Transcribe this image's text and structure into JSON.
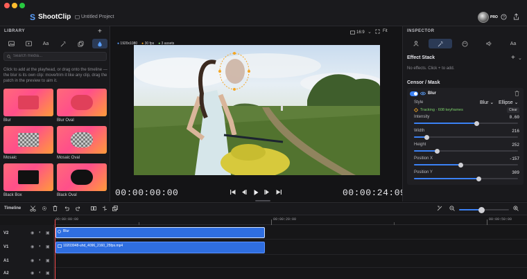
{
  "app": {
    "name": "ShootClip",
    "project": "Untitled Project",
    "badge": "PRO"
  },
  "library": {
    "title": "LIBRARY",
    "tabs": [
      "image-icon",
      "video-icon",
      "text-icon",
      "magic-icon",
      "layers-icon",
      "droplet-icon"
    ],
    "tab_text": "Aa",
    "search_placeholder": "Search media...",
    "hint": "Click to add at the playhead, or drag onto the timeline — the blur is its own clip: move/trim it like any clip, drag the patch in the preview to aim it.",
    "items": [
      {
        "label": "Blur",
        "shape": "rect"
      },
      {
        "label": "Blur Oval",
        "shape": "oval"
      },
      {
        "label": "Mosaic",
        "shape": "mosaic-rect"
      },
      {
        "label": "Mosaic Oval",
        "shape": "mosaic-oval"
      },
      {
        "label": "Black Box",
        "shape": "black-rect"
      },
      {
        "label": "Black Oval",
        "shape": "black-oval"
      }
    ]
  },
  "preview": {
    "aspect": "16:9",
    "fit": "Fit",
    "badges": [
      "1920x1080",
      "30 fps",
      "3 assets"
    ],
    "current_time": "00:00:00:00",
    "duration": "00:00:24:09"
  },
  "inspector": {
    "title": "INSPECTOR",
    "effect_stack_title": "Effect Stack",
    "no_effects": "No effects. Click + to add.",
    "censor_title": "Censor / Mask",
    "effect_name": "Blur",
    "style_label": "Style",
    "style_value": "Blur",
    "shape_value": "Ellipse",
    "tracking": "Tracking · 608 keyframes",
    "clear": "Clear",
    "props": [
      {
        "label": "Intensity",
        "value": "0.60",
        "fraction": 0.6
      },
      {
        "label": "Width",
        "value": "216",
        "fraction": 0.12
      },
      {
        "label": "Height",
        "value": "252",
        "fraction": 0.22
      },
      {
        "label": "Position X",
        "value": "-157",
        "fraction": 0.45
      },
      {
        "label": "Position Y",
        "value": "309",
        "fraction": 0.62
      }
    ]
  },
  "timeline": {
    "title": "Timeline",
    "ruler": [
      "00:00:00:00",
      "00:00:20:00",
      "00:00:50:00"
    ],
    "tracks": [
      "V2",
      "V1",
      "A1",
      "A2"
    ],
    "clips": [
      {
        "track": "V2",
        "label": "Blur"
      },
      {
        "track": "V1",
        "label": "10203948-uhd_4096_2160_25fps.mp4"
      }
    ],
    "zoom": 0.45
  },
  "colors": {
    "accent": "#3b82f6",
    "clip": "#2f6ee0",
    "tracking": "#f5a623",
    "green": "#7dd36b"
  }
}
